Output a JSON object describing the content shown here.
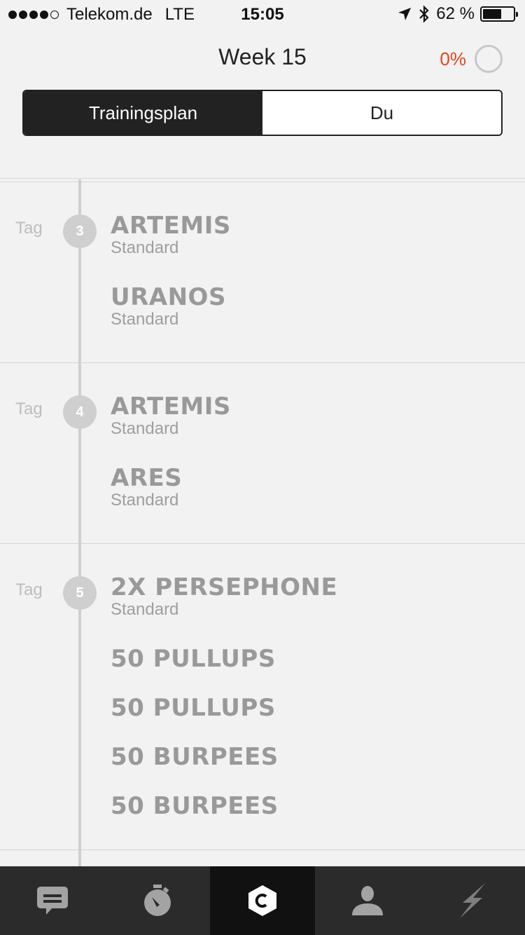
{
  "status_bar": {
    "carrier": "Telekom.de",
    "network": "LTE",
    "time": "15:05",
    "battery_text": "62 %",
    "battery_level": 0.62,
    "signal_bars": 4,
    "icons": [
      "location-arrow-icon",
      "bluetooth-icon",
      "battery-icon"
    ]
  },
  "header": {
    "title": "Week 15",
    "progress_text": "0%",
    "progress_color": "#e8431e"
  },
  "segmented": {
    "options": [
      {
        "label": "Trainingsplan",
        "active": true
      },
      {
        "label": "Du",
        "active": false
      }
    ]
  },
  "days": [
    {
      "label": "Tag",
      "number": "3",
      "workouts": [
        {
          "name": "ARTEMIS",
          "sub": "Standard"
        },
        {
          "name": "URANOS",
          "sub": "Standard"
        }
      ]
    },
    {
      "label": "Tag",
      "number": "4",
      "workouts": [
        {
          "name": "ARTEMIS",
          "sub": "Standard"
        },
        {
          "name": "ARES",
          "sub": "Standard"
        }
      ]
    },
    {
      "label": "Tag",
      "number": "5",
      "workouts": [
        {
          "name": "2X PERSEPHONE",
          "sub": "Standard"
        },
        {
          "name": "50 PULLUPS"
        },
        {
          "name": "50 PULLUPS"
        },
        {
          "name": "50 BURPEES"
        },
        {
          "name": "50 BURPEES"
        }
      ]
    }
  ],
  "tabbar": {
    "tabs": [
      {
        "icon": "chat-icon",
        "selected": false
      },
      {
        "icon": "stopwatch-icon",
        "selected": false
      },
      {
        "icon": "coach-logo-icon",
        "selected": true
      },
      {
        "icon": "profile-icon",
        "selected": false
      },
      {
        "icon": "lightning-icon",
        "selected": false
      }
    ]
  }
}
